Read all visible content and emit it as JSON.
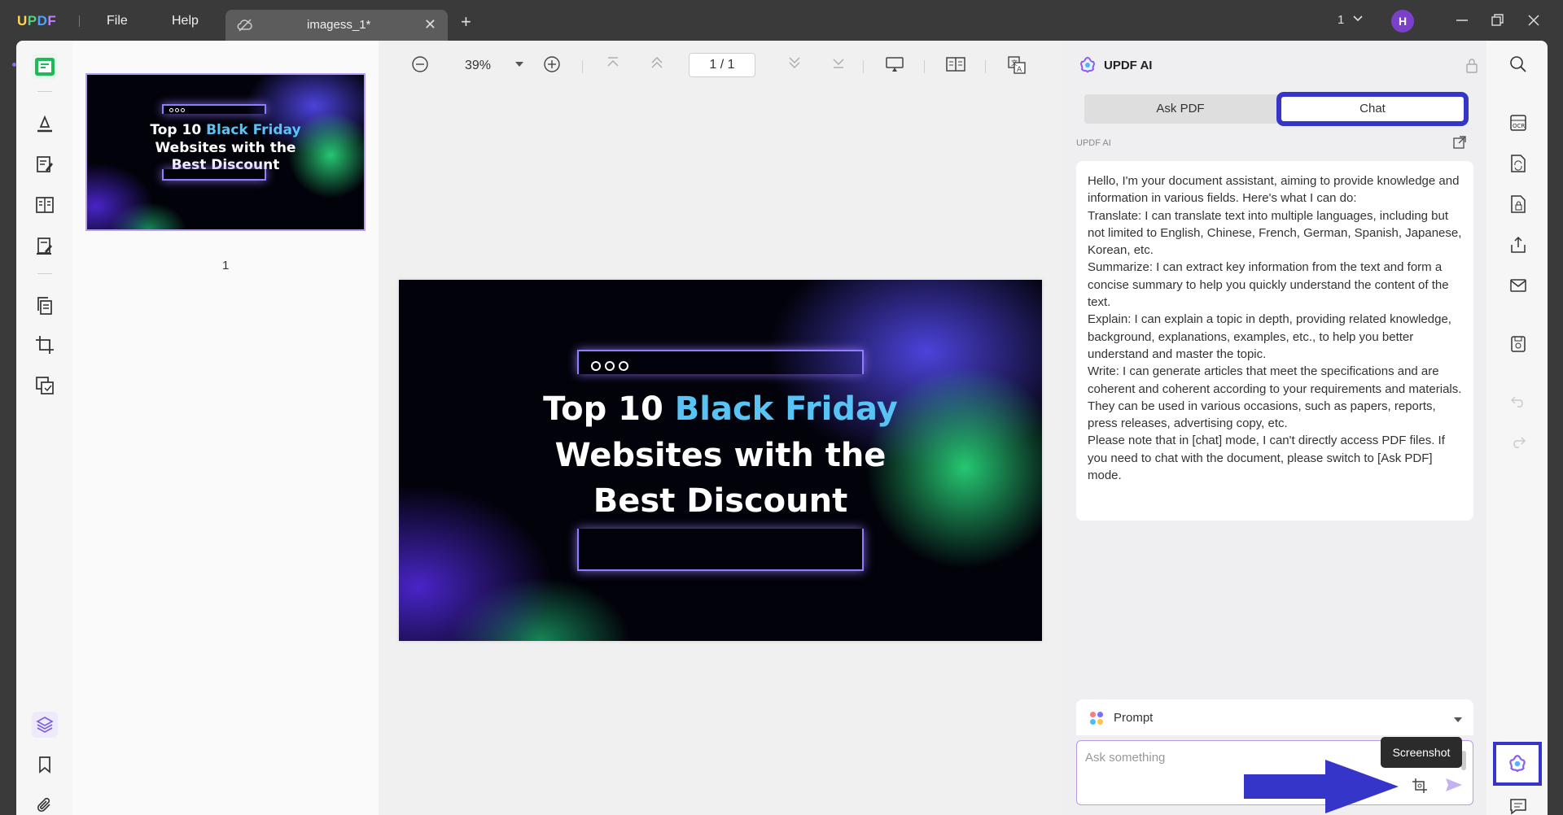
{
  "app": {
    "logo": [
      "U",
      "P",
      "D",
      "F"
    ],
    "menu": {
      "file": "File",
      "help": "Help"
    },
    "tab_title": "imagess_1*",
    "page_count_label": "1",
    "user_initial": "H"
  },
  "viewer": {
    "zoom": "39%",
    "page_indicator": "1 / 1"
  },
  "thumbnail": {
    "page_number": "1"
  },
  "slide": {
    "line1_a": "Top 10 ",
    "line1_b": "Black Friday",
    "line2": "Websites with the",
    "line3": "Best Discount"
  },
  "ai_panel": {
    "title": "UPDF AI",
    "tabs": {
      "ask_pdf": "Ask PDF",
      "chat": "Chat"
    },
    "source_label": "UPDF AI",
    "message": [
      "Hello, I'm your document assistant, aiming to provide knowledge and information in various fields. Here's what I can do:",
      "Translate: I can translate text into multiple languages, including but not limited to English, Chinese, French, German, Spanish, Japanese, Korean, etc.",
      "Summarize: I can extract key information from the text and form a concise summary to help you quickly understand the content of the text.",
      "Explain: I can explain a topic in depth, providing related knowledge, background, explanations, examples, etc., to help you better understand and master the topic.",
      "Write: I can generate articles that meet the specifications and are coherent and coherent according to your requirements and materials. They can be used in various occasions, such as papers, reports, press releases, advertising copy, etc.",
      "Please note that in [chat] mode, I can't directly access PDF files. If you need to chat with the document, please switch to [Ask PDF] mode."
    ],
    "prompt_label": "Prompt",
    "input_placeholder": "Ask something",
    "tooltip": "Screenshot"
  },
  "colors": {
    "highlight_box": "#3535c9",
    "annotation_arrow": "#3535c9",
    "slide_blue_text": "#57c4f5",
    "slide_green_text": "#3ee07a"
  }
}
